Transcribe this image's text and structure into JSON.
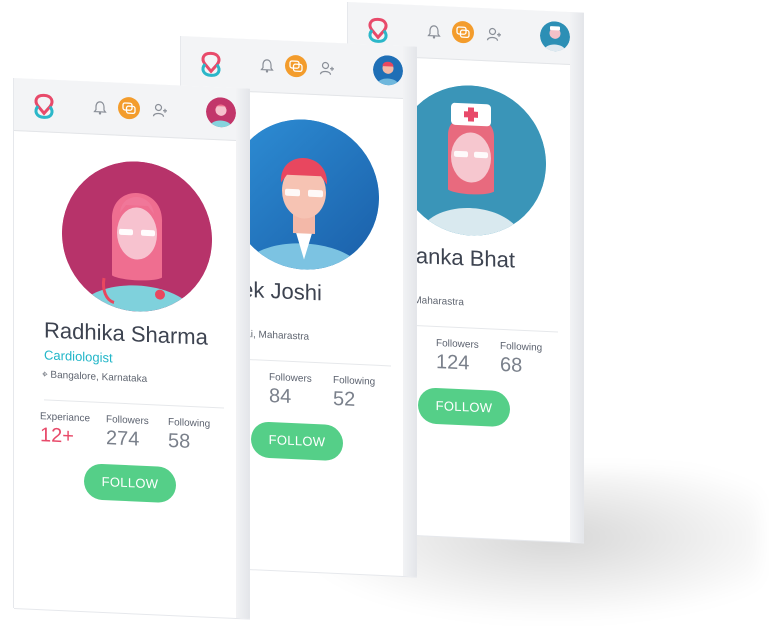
{
  "app": {
    "logo_icon": "double-loop-logo",
    "header_icons": [
      "bell-icon",
      "chat-icon",
      "add-user-icon"
    ]
  },
  "colors": {
    "accent_orange": "#f39c2c",
    "follow_green": "#55cf88",
    "specialty_teal": "#22b6c8",
    "experience_red": "#e84a6a",
    "logo_pink": "#e84a6a",
    "logo_teal": "#2bb7c9"
  },
  "cards": [
    {
      "name": "Radhika Sharma",
      "specialty": "Cardiologist",
      "location": "Bangalore, Karnataka",
      "experience_label": "Experiance",
      "experience_value": "12+",
      "followers_label": "Followers",
      "followers_value": "274",
      "following_label": "Following",
      "following_value": "58",
      "follow_label": "FOLLOW"
    },
    {
      "name": "Vivek Joshi",
      "location": "Mumbai, Maharastra",
      "followers_label": "Followers",
      "followers_value": "84",
      "following_label": "Following",
      "following_value": "52",
      "follow_label": "FOLLOW"
    },
    {
      "name": "Priyanka Bhat",
      "location": "Pune, Maharastra",
      "followers_label": "Followers",
      "followers_value": "124",
      "following_label": "Following",
      "following_value": "68",
      "follow_label": "FOLLOW"
    }
  ]
}
